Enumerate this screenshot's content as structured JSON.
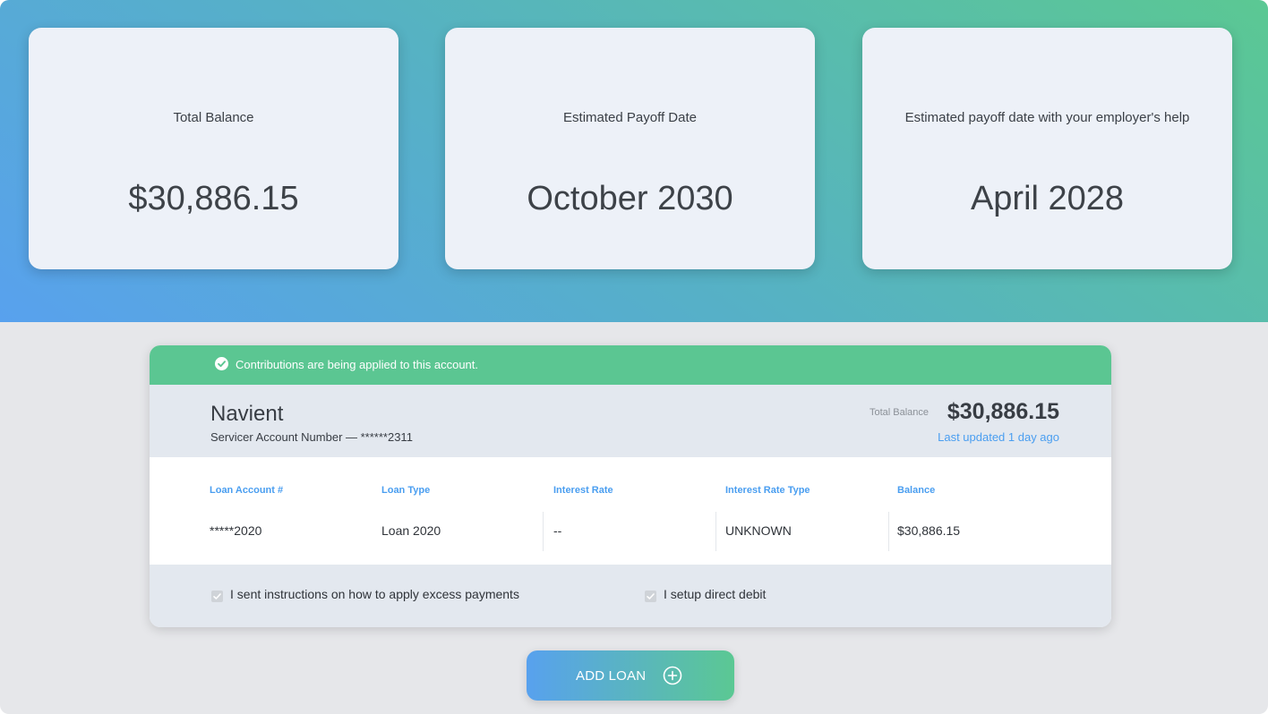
{
  "summary": [
    {
      "label": "Total Balance",
      "value": "$30,886.15"
    },
    {
      "label": "Estimated Payoff Date",
      "value": "October 2030"
    },
    {
      "label": "Estimated payoff date with your employer's help",
      "value": "April 2028"
    }
  ],
  "loan": {
    "banner": "Contributions are being applied to this account.",
    "servicer_name": "Navient",
    "account_number": "Servicer Account Number — ******2311",
    "total_balance_label": "Total Balance",
    "total_balance": "$30,886.15",
    "last_updated": "Last updated 1 day ago",
    "columns": [
      "Loan Account #",
      "Loan Type",
      "Interest Rate",
      "Interest Rate Type",
      "Balance"
    ],
    "row": [
      "*****2020",
      "Loan 2020",
      "--",
      "UNKNOWN",
      "$30,886.15"
    ],
    "checkboxes": [
      {
        "label": "I sent instructions on how to apply excess payments",
        "checked": true
      },
      {
        "label": "I setup direct debit",
        "checked": true
      }
    ]
  },
  "add_loan_label": "ADD LOAN",
  "colors": {
    "accent_blue": "#4a9ef0",
    "accent_green": "#5bc692",
    "gradient_start": "#58a1ee",
    "gradient_end": "#5bc893"
  }
}
